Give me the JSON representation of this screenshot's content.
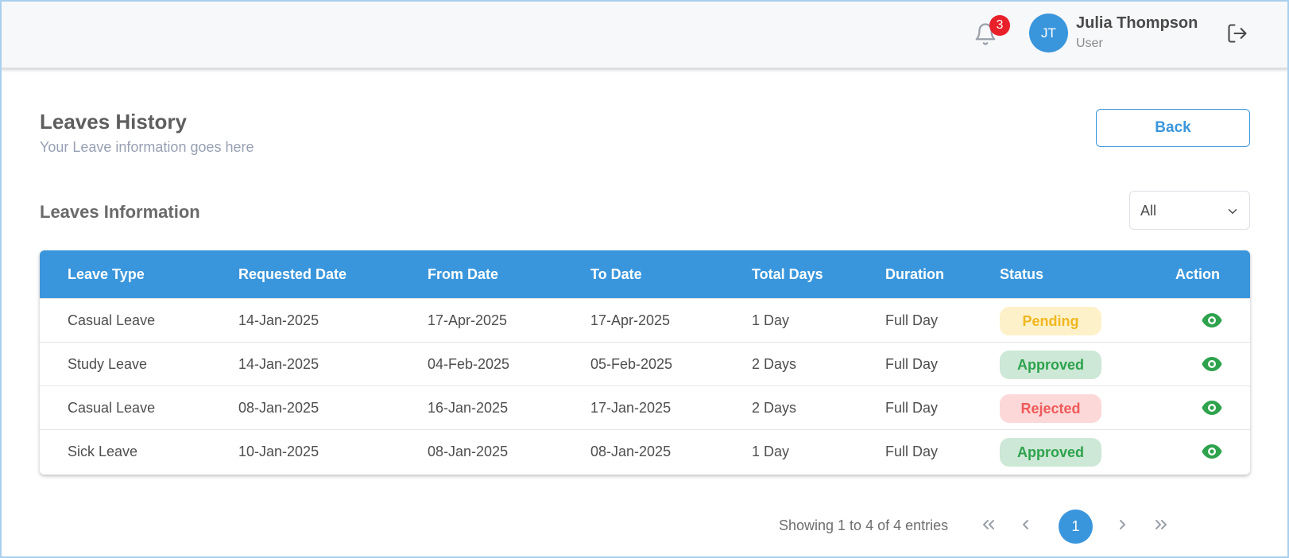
{
  "header": {
    "notifications_count": "3",
    "user_initials": "JT",
    "user_name": "Julia Thompson",
    "user_role": "User"
  },
  "page": {
    "title": "Leaves History",
    "subtitle": "Your Leave information goes here",
    "back_label": "Back"
  },
  "section": {
    "title": "Leaves Information",
    "filter_value": "All"
  },
  "table": {
    "columns": [
      "Leave Type",
      "Requested Date",
      "From Date",
      "To Date",
      "Total Days",
      "Duration",
      "Status",
      "Action"
    ],
    "rows": [
      {
        "type": "Casual Leave",
        "requested": "14-Jan-2025",
        "from": "17-Apr-2025",
        "to": "17-Apr-2025",
        "days": "1 Day",
        "duration": "Full Day",
        "status": "Pending"
      },
      {
        "type": "Study Leave",
        "requested": "14-Jan-2025",
        "from": "04-Feb-2025",
        "to": "05-Feb-2025",
        "days": "2 Days",
        "duration": "Full Day",
        "status": "Approved"
      },
      {
        "type": "Casual Leave",
        "requested": "08-Jan-2025",
        "from": "16-Jan-2025",
        "to": "17-Jan-2025",
        "days": "2 Days",
        "duration": "Full Day",
        "status": "Rejected"
      },
      {
        "type": "Sick Leave",
        "requested": "10-Jan-2025",
        "from": "08-Jan-2025",
        "to": "08-Jan-2025",
        "days": "1 Day",
        "duration": "Full Day",
        "status": "Approved"
      }
    ]
  },
  "pagination": {
    "info": "Showing 1 to 4 of 4 entries",
    "current_page": "1"
  },
  "colors": {
    "accent": "#3a96dc",
    "pending": "#f0b720",
    "approved": "#2ea24c",
    "rejected": "#ef5a5a",
    "badge": "#e8202a"
  },
  "icons": {
    "notifications": "bell-icon",
    "logout": "logout-icon",
    "view": "eye-icon",
    "dropdown": "chevron-down-icon"
  }
}
